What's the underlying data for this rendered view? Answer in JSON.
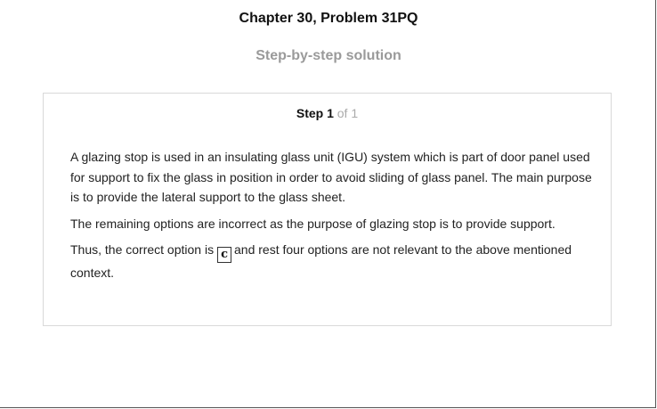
{
  "page": {
    "title": "Chapter 30, Problem 31PQ",
    "subtitle": "Step-by-step solution"
  },
  "step": {
    "label": "Step 1",
    "of_text": "of 1"
  },
  "solution": {
    "paragraph1": "A glazing stop is used in an insulating glass unit (IGU) system which is part of door panel used for support to fix the glass in position in order to avoid sliding of glass panel. The main purpose is to provide the lateral support to the glass sheet.",
    "paragraph2": "The remaining options are incorrect as the purpose of glazing stop is to provide support.",
    "paragraph3_before": "Thus, the correct option is",
    "answer": "c",
    "paragraph3_after": "and rest four options are not relevant to the above mentioned context."
  }
}
